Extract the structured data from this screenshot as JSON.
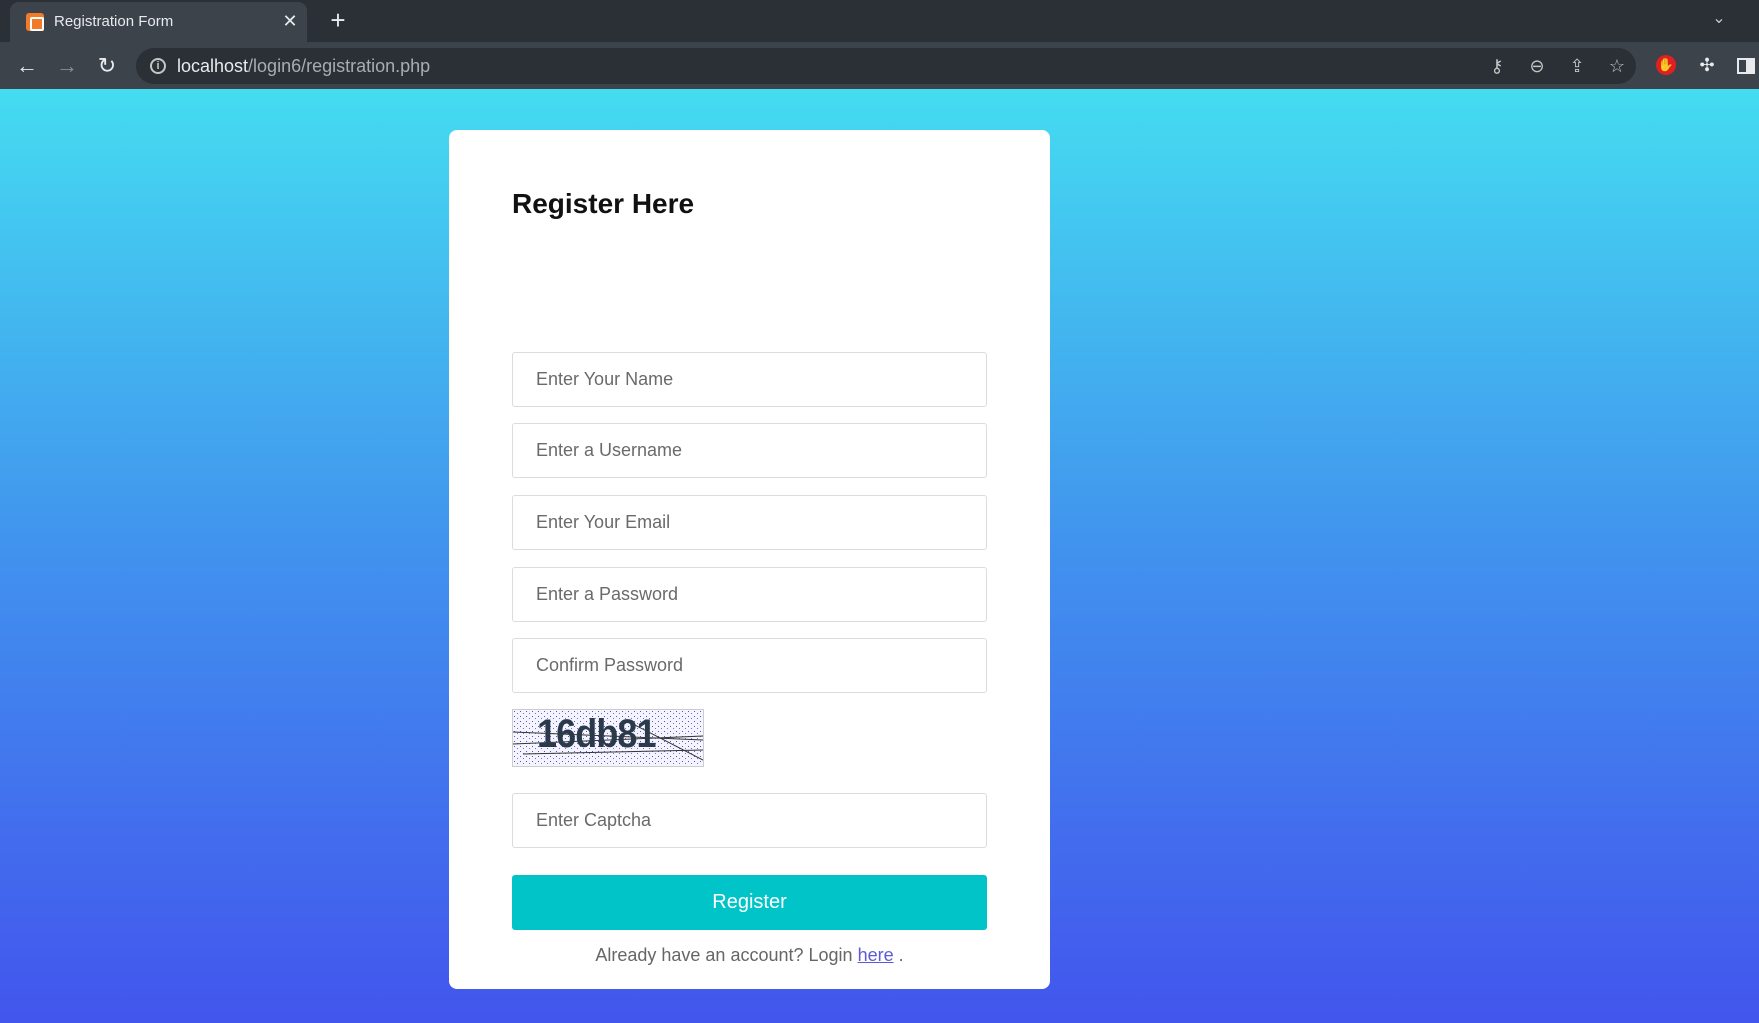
{
  "browser": {
    "tab_title": "Registration Form",
    "new_tab_symbol": "+",
    "url_host": "localhost",
    "url_path": "/login6/registration.php"
  },
  "form": {
    "title": "Register Here",
    "name_placeholder": "Enter Your Name",
    "username_placeholder": "Enter a Username",
    "email_placeholder": "Enter Your Email",
    "password_placeholder": "Enter a Password",
    "confirm_placeholder": "Confirm Password",
    "captcha_code": "16db81",
    "captcha_placeholder": "Enter Captcha",
    "register_label": "Register",
    "login_prefix": "Already have an account? Login",
    "login_link": "here",
    "login_suffix": "."
  },
  "colors": {
    "gradient_top": "#44dcf0",
    "gradient_bottom": "#4255ed",
    "button": "#00c4c8",
    "link": "#5b5bd6"
  }
}
